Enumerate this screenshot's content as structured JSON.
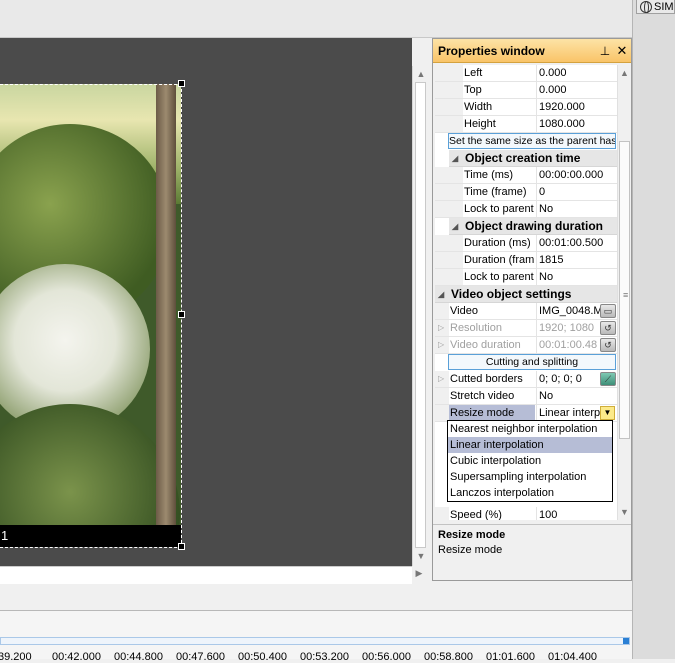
{
  "right_tab": {
    "label": "SIM"
  },
  "video": {
    "subtitle_fragment": "1"
  },
  "properties": {
    "title": "Properties window",
    "pin_glyph": "⊥",
    "close_glyph": "✕",
    "rows_position": [
      {
        "key": "Left",
        "value": "0.000"
      },
      {
        "key": "Top",
        "value": "0.000"
      },
      {
        "key": "Width",
        "value": "1920.000"
      },
      {
        "key": "Height",
        "value": "1080.000"
      }
    ],
    "same_size_button": "Set the same size as the parent has",
    "cat_creation": "Object creation time",
    "rows_creation": [
      {
        "key": "Time (ms)",
        "value": "00:00:00.000"
      },
      {
        "key": "Time (frame)",
        "value": "0"
      },
      {
        "key": "Lock to parent",
        "value": "No"
      }
    ],
    "cat_duration": "Object drawing duration",
    "rows_duration": [
      {
        "key": "Duration (ms)",
        "value": "00:01:00.500"
      },
      {
        "key": "Duration (fram",
        "value": "1815"
      },
      {
        "key": "Lock to parent",
        "value": "No"
      }
    ],
    "cat_video": "Video object settings",
    "rows_video": [
      {
        "key": "Video",
        "value": "IMG_0048.M"
      },
      {
        "key": "Resolution",
        "value": "1920; 1080"
      },
      {
        "key": "Video duration",
        "value": "00:01:00.48"
      }
    ],
    "cutting_button": "Cutting and splitting",
    "rows_after": [
      {
        "key": "Cutted borders",
        "value": "0; 0; 0; 0"
      },
      {
        "key": "Stretch video",
        "value": "No"
      },
      {
        "key": "Resize mode",
        "value": "Linear interp"
      }
    ],
    "resize_options": [
      "Nearest neighbor interpolation",
      "Linear interpolation",
      "Cubic interpolation",
      "Supersampling interpolation",
      "Lanczos interpolation"
    ],
    "selected_resize_option": 1,
    "speed_row": {
      "key": "Speed (%)",
      "value": "100"
    },
    "help_title": "Resize mode",
    "help_description": "Resize mode"
  },
  "timeline": {
    "ticks": [
      "39.200",
      "00:42.000",
      "00:44.800",
      "00:47.600",
      "00:50.400",
      "00:53.200",
      "00:56.000",
      "00:58.800",
      "01:01.600",
      "01:04.400"
    ]
  }
}
